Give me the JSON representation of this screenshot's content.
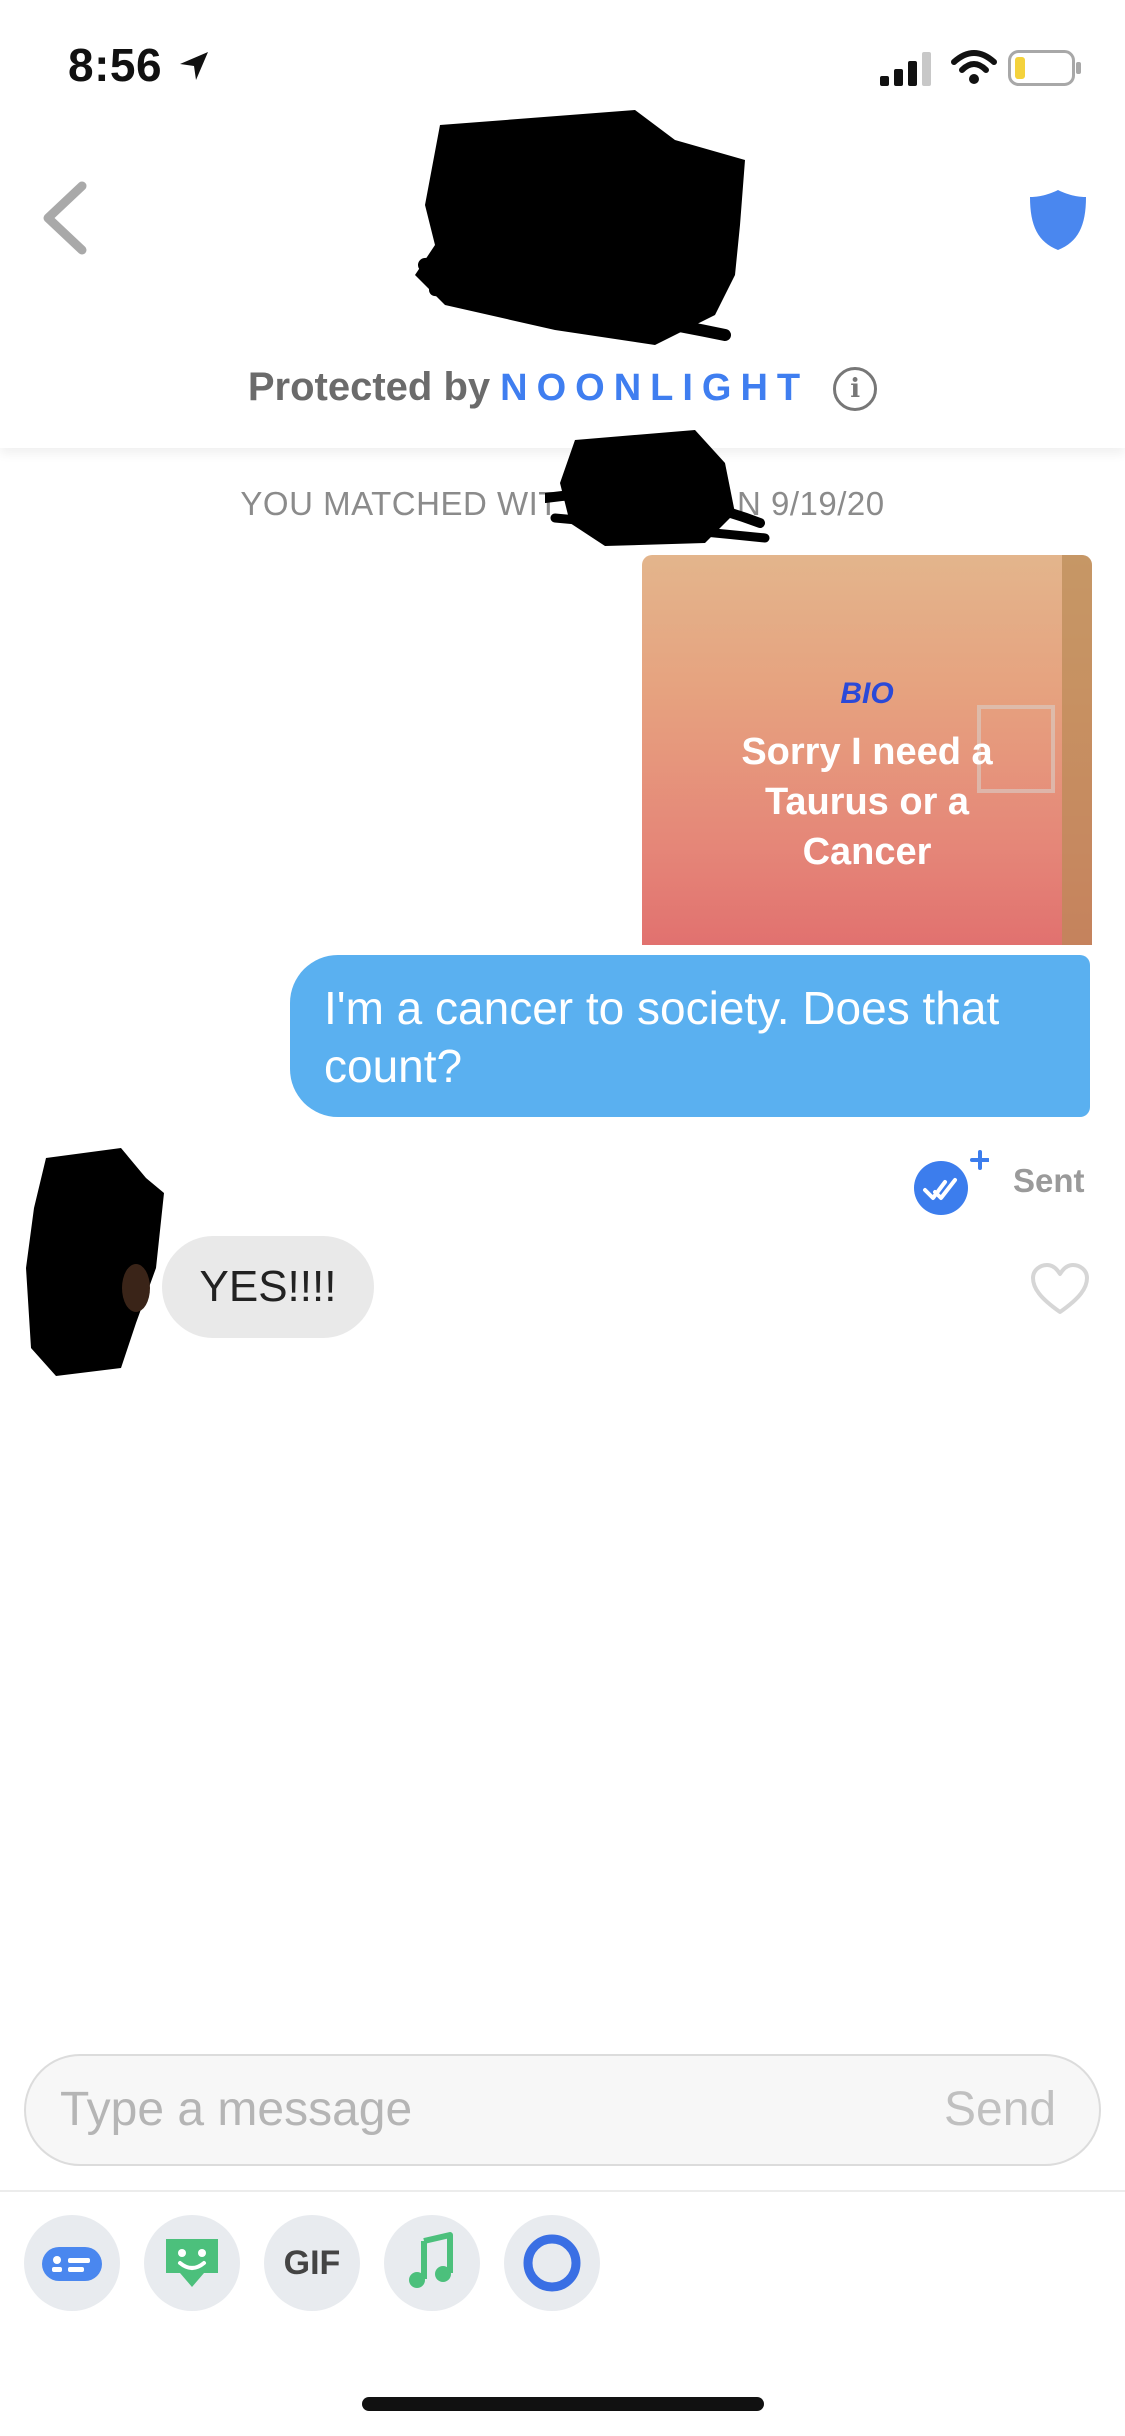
{
  "status_bar": {
    "time": "8:56"
  },
  "header": {
    "protected_by": "Protected by",
    "brand": "NOONLIGHT",
    "info": "i"
  },
  "conversation": {
    "matched_text": "YOU MATCHED WIT",
    "matched_date": "N 9/19/20",
    "bio_card": {
      "label": "BIO",
      "text": "Sorry I need a Taurus or a Cancer"
    },
    "outgoing_message": "I'm a cancer to society. Does that count?",
    "status": "Sent",
    "incoming_message": "YES!!!!"
  },
  "composer": {
    "placeholder": "Type a message",
    "send_label": "Send",
    "gif_label": "GIF"
  },
  "colors": {
    "accent_blue": "#3f7ef0",
    "bubble_blue": "#5ab0f0",
    "bubble_gray": "#e9e9e9"
  },
  "icons": [
    "location-arrow-icon",
    "signal-icon",
    "wifi-icon",
    "battery-icon",
    "back-chevron-icon",
    "shield-icon",
    "info-icon",
    "double-check-icon",
    "heart-icon",
    "keyboard-card-icon",
    "sticker-icon",
    "gif-icon",
    "music-note-icon",
    "ring-icon"
  ]
}
